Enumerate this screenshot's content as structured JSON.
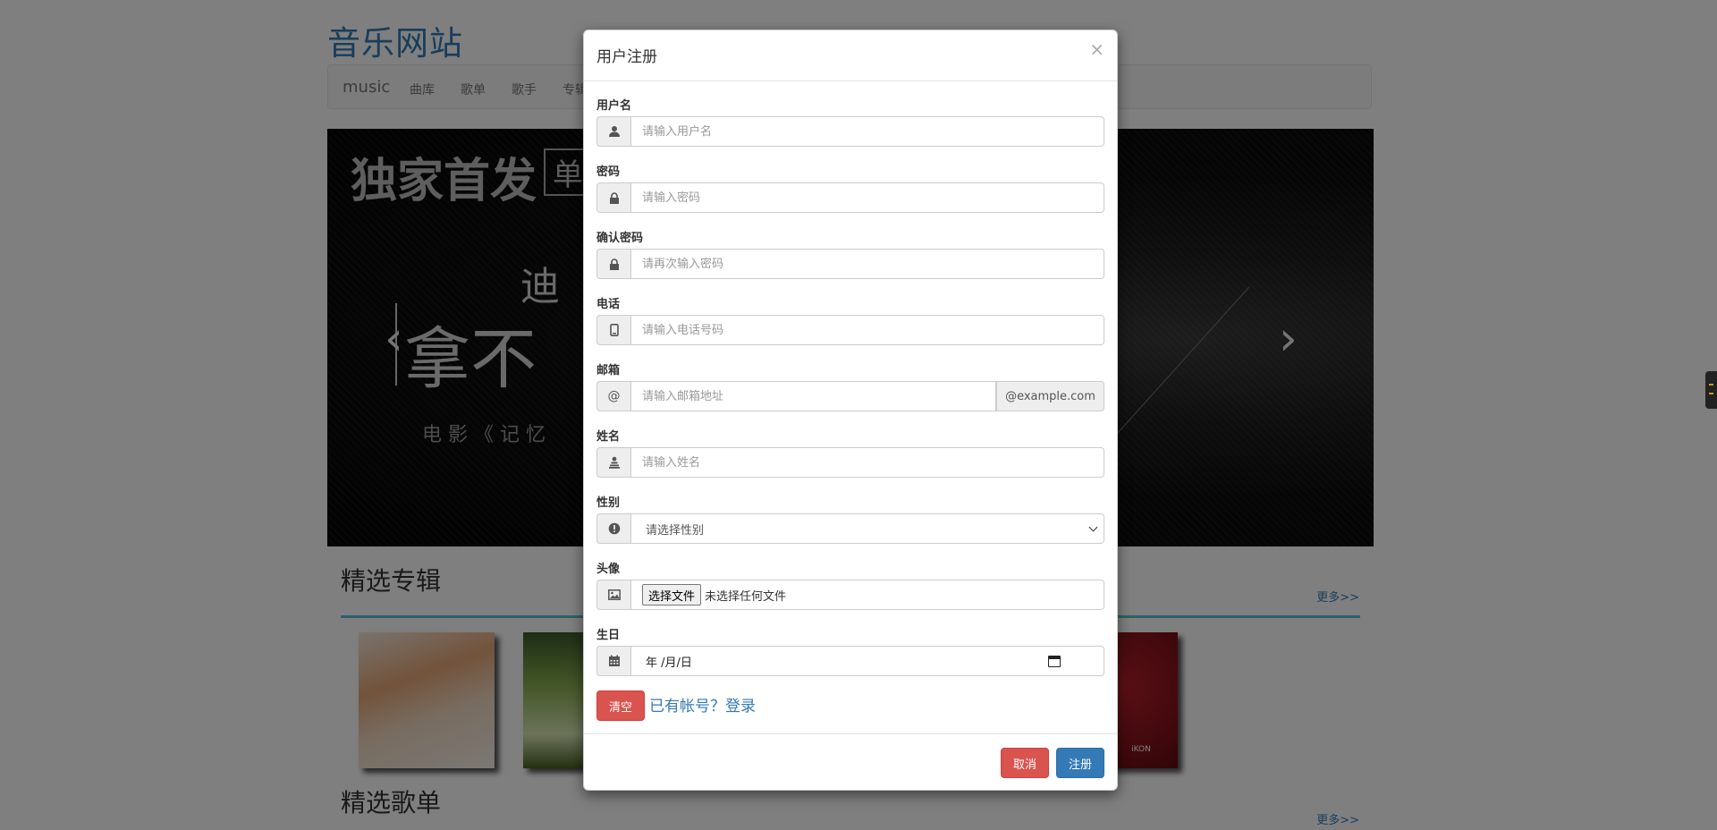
{
  "site": {
    "title": "音乐网站",
    "navbar": {
      "brand": "music",
      "links": [
        "曲库",
        "歌单",
        "歌手",
        "专辑"
      ]
    },
    "carousel": {
      "lines": [
        "独家首发",
        "单",
        "迪",
        "拿不",
        "电 影 《 记 忆"
      ]
    },
    "sections": [
      {
        "title": "精选专辑",
        "more": "更多>>"
      },
      {
        "title": "精选歌单",
        "more": "更多>>"
      }
    ],
    "album_labels": [
      "iKON"
    ]
  },
  "modal": {
    "title": "用户注册",
    "close": "×",
    "fields": [
      {
        "label": "用户名",
        "placeholder": "请输入用户名",
        "icon": "user-icon"
      },
      {
        "label": "密码",
        "placeholder": "请输入密码",
        "icon": "lock-icon"
      },
      {
        "label": "确认密码",
        "placeholder": "请再次输入密码",
        "icon": "lock-icon"
      },
      {
        "label": "电话",
        "placeholder": "请输入电话号码",
        "icon": "phone-icon"
      },
      {
        "label": "邮箱",
        "placeholder": "请输入邮箱地址",
        "icon": "at-icon",
        "addon_text": "@",
        "suffix": "@example.com"
      },
      {
        "label": "姓名",
        "placeholder": "请输入姓名",
        "icon": "person-icon"
      },
      {
        "label": "性别",
        "selected": "请选择性别",
        "icon": "info-icon"
      },
      {
        "label": "头像",
        "file_button": "选择文件",
        "file_status": "未选择任何文件",
        "icon": "image-icon"
      },
      {
        "label": "生日",
        "date_value": "年 /月/日",
        "icon": "calendar-icon"
      }
    ],
    "clear_button": "清空",
    "login_link": "已有帐号？登录",
    "cancel_button": "取消",
    "submit_button": "注册"
  },
  "colors": {
    "brand_blue": "#337ab7",
    "danger": "#d9534f",
    "accent_rule": "#5bc0de",
    "overlay": "rgba(0,0,0,0.5)"
  }
}
